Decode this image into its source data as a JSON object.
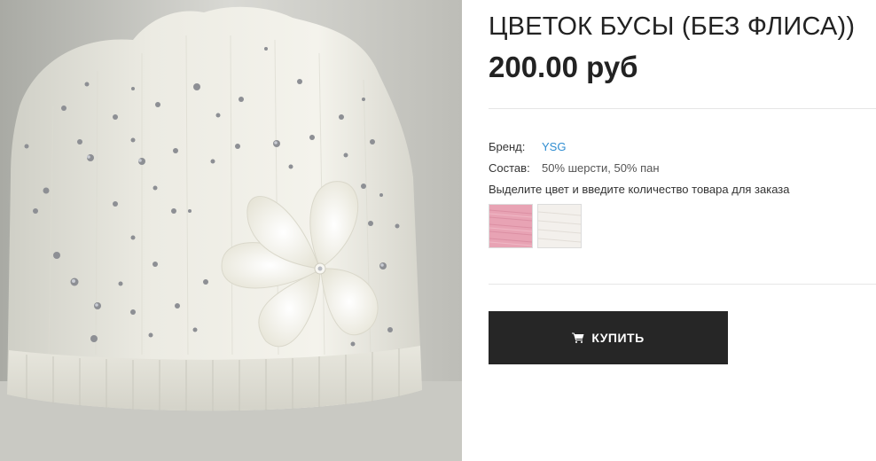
{
  "product": {
    "title": "ЦВЕТОК БУСЫ (БЕЗ ФЛИСА))",
    "price": "200.00 руб"
  },
  "attributes": {
    "brand_label": "Бренд:",
    "brand_value": "YSG",
    "composition_label": "Состав:",
    "composition_value": "50% шерсти, 50% пан"
  },
  "instruction": "Выделите цвет и введите количество товара для заказа",
  "swatches": [
    {
      "name": "pink",
      "color": "#e8a3b4"
    },
    {
      "name": "white",
      "color": "#f3f0ec"
    }
  ],
  "buy_button": {
    "label": "КУПИТЬ",
    "icon": "cart-icon"
  },
  "colors": {
    "link": "#2f8dd1",
    "button_bg": "#262626",
    "button_text": "#ffffff"
  }
}
